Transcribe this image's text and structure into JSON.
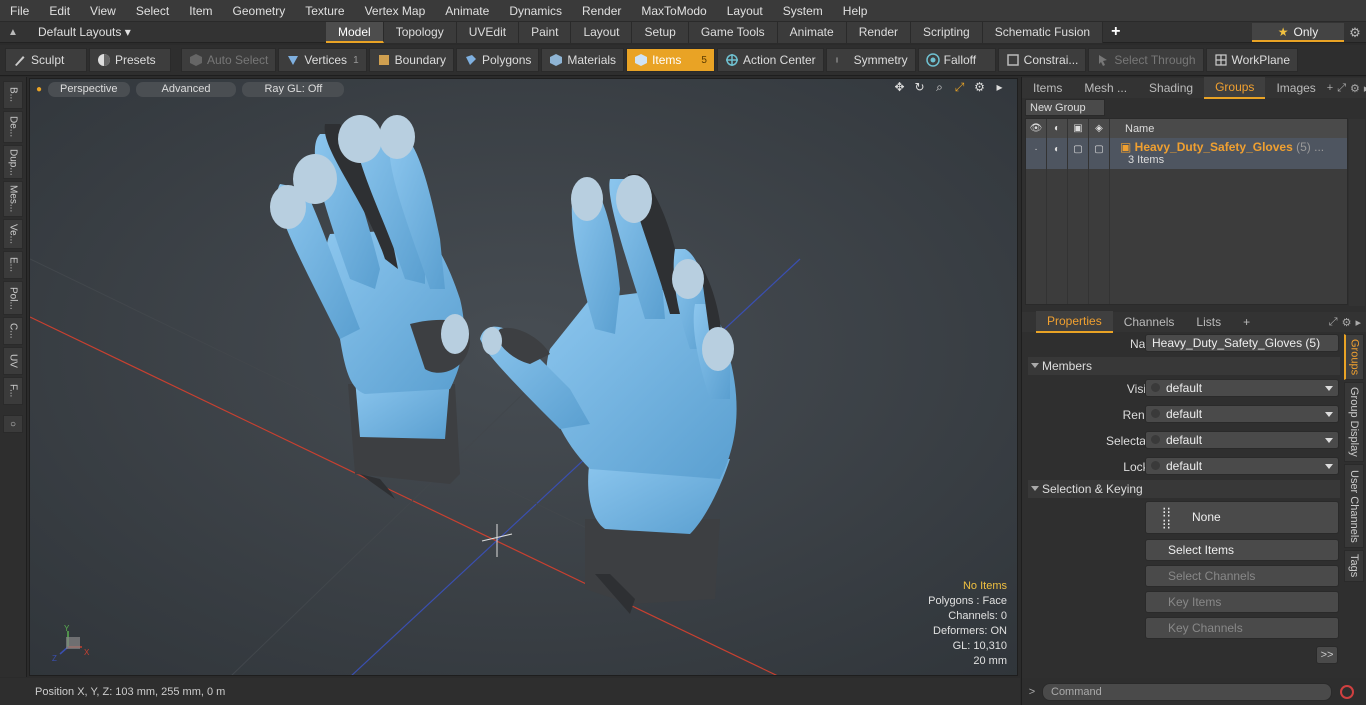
{
  "menubar": {
    "items": [
      "File",
      "Edit",
      "View",
      "Select",
      "Item",
      "Geometry",
      "Texture",
      "Vertex Map",
      "Animate",
      "Dynamics",
      "Render",
      "MaxToModo",
      "Layout",
      "System",
      "Help"
    ]
  },
  "layoutbar": {
    "layouts_label": "Default Layouts ▾",
    "tabs": [
      "Model",
      "Topology",
      "UVEdit",
      "Paint",
      "Layout",
      "Setup",
      "Game Tools",
      "Animate",
      "Render",
      "Scripting",
      "Schematic Fusion"
    ],
    "active_tab": "Model",
    "plus": "+",
    "only_label": "Only"
  },
  "toolbar": {
    "sculpt": "Sculpt",
    "presets": "Presets",
    "auto_select": "Auto Select",
    "vertices": "Vertices",
    "vertices_count": "1",
    "boundary": "Boundary",
    "polygons": "Polygons",
    "materials": "Materials",
    "items": "Items",
    "items_count": "5",
    "action_center": "Action Center",
    "symmetry": "Symmetry",
    "falloff": "Falloff",
    "constraints": "Constrai...",
    "select_through": "Select Through",
    "workplane": "WorkPlane"
  },
  "leftstrip": {
    "tabs": [
      "B...",
      "De...",
      "Dup...",
      "Mes...",
      "Ve...",
      "E...",
      "Pol...",
      "C...",
      "UV",
      "F..."
    ]
  },
  "viewport": {
    "perspective": "Perspective",
    "advanced": "Advanced",
    "raygl": "Ray GL: Off",
    "stats": {
      "no_items": "No Items",
      "polygons": "Polygons : Face",
      "channels": "Channels: 0",
      "deformers": "Deformers: ON",
      "gl": "GL: 10,310",
      "scale": "20 mm"
    },
    "axis_labels": {
      "y": "Y",
      "x": "X",
      "z": "Z"
    }
  },
  "statusbar": {
    "position": "Position X, Y, Z:   103 mm, 255 mm, 0 m"
  },
  "rightpanel": {
    "top_tabs": [
      "Items",
      "Mesh ...",
      "Shading",
      "Groups",
      "Images"
    ],
    "top_active": "Groups",
    "new_group": "New Group",
    "col_name": "Name",
    "group_name": "Heavy_Duty_Safety_Gloves",
    "group_count": "(5) ...",
    "group_items": "3 Items",
    "prop_tabs": [
      "Properties",
      "Channels",
      "Lists"
    ],
    "prop_active": "Properties",
    "name_label": "Name",
    "name_value": "Heavy_Duty_Safety_Gloves (5)",
    "members_section": "Members",
    "visible_label": "Visible",
    "render_label": "Render",
    "selectable_label": "Selectable",
    "locked_label": "Locked",
    "default_value": "default",
    "selkey_section": "Selection & Keying",
    "none_btn": "None",
    "select_items": "Select Items",
    "select_channels": "Select Channels",
    "key_items": "Key Items",
    "key_channels": "Key Channels",
    "more": ">>",
    "side_tabs": [
      "Groups",
      "Group Display",
      "User Channels",
      "Tags"
    ],
    "command_placeholder": "Command"
  },
  "colors": {
    "accent": "#e9a325",
    "glove_blue": "#6fb3e0",
    "glove_dark": "#3d3f42",
    "axis_red": "#c84030",
    "axis_blue": "#3a4fb0"
  }
}
